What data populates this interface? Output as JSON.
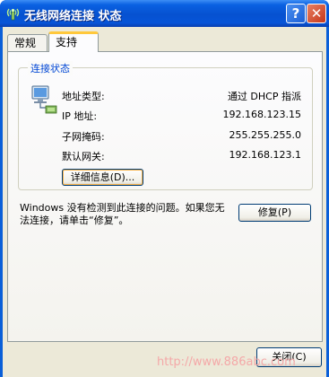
{
  "window": {
    "title": "无线网络连接 状态",
    "colors": {
      "titlebar": "#0651d0",
      "client": "#ece9d8",
      "accent_tab": "#ffc83c",
      "group_label": "#0046d5"
    },
    "icon": "wireless-network-icon"
  },
  "titlebar_buttons": {
    "help": "?",
    "close": "✕"
  },
  "tabs": [
    {
      "label": "常规",
      "selected": false
    },
    {
      "label": "支持",
      "selected": true
    }
  ],
  "connection_status": {
    "heading": "连接状态",
    "icon": "network-adapter-icon",
    "rows": [
      {
        "label": "地址类型:",
        "value": "通过 DHCP 指派"
      },
      {
        "label": "IP 地址:",
        "value": "192.168.123.15"
      },
      {
        "label": "子网掩码:",
        "value": "255.255.255.0"
      },
      {
        "label": "默认网关:",
        "value": "192.168.123.1"
      }
    ],
    "details_button": "详细信息(D)..."
  },
  "repair": {
    "message": "Windows 没有检测到此连接的问题。如果您无法连接，请单击“修复”。",
    "button": "修复(P)"
  },
  "footer": {
    "close_button": "关闭(C)"
  },
  "watermark": "http://www.886abc.com"
}
